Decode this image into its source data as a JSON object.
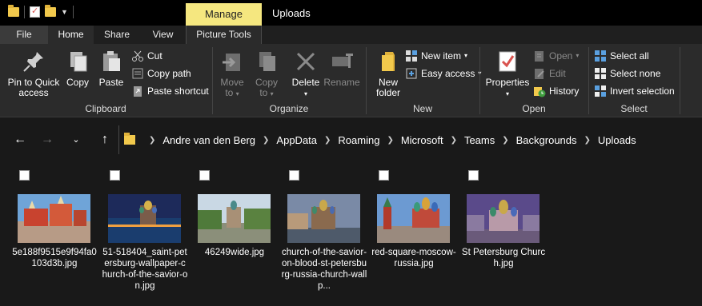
{
  "titlebar": {
    "manage_tab": "Manage",
    "window_title": "Uploads"
  },
  "tabs": {
    "file": "File",
    "home": "Home",
    "share": "Share",
    "view": "View",
    "picture_tools": "Picture Tools"
  },
  "ribbon": {
    "clipboard": {
      "label": "Clipboard",
      "pin_line1": "Pin to Quick",
      "pin_line2": "access",
      "copy": "Copy",
      "paste": "Paste",
      "cut": "Cut",
      "copy_path": "Copy path",
      "paste_shortcut": "Paste shortcut"
    },
    "organize": {
      "label": "Organize",
      "move_to_line1": "Move",
      "move_to_line2": "to",
      "copy_to_line1": "Copy",
      "copy_to_line2": "to",
      "delete": "Delete",
      "rename": "Rename"
    },
    "new": {
      "label": "New",
      "new_folder_line1": "New",
      "new_folder_line2": "folder",
      "new_item": "New item",
      "easy_access": "Easy access"
    },
    "open": {
      "label": "Open",
      "properties": "Properties",
      "open": "Open",
      "edit": "Edit",
      "history": "History"
    },
    "select": {
      "label": "Select",
      "select_all": "Select all",
      "select_none": "Select none",
      "invert_selection": "Invert selection"
    }
  },
  "nav": {
    "breadcrumbs": [
      "Andre van den Berg",
      "AppData",
      "Roaming",
      "Microsoft",
      "Teams",
      "Backgrounds",
      "Uploads"
    ]
  },
  "files": [
    {
      "name": "5e188f9515e9f94fa0103d3b.jpg"
    },
    {
      "name": "51-518404_saint-petersburg-wallpaper-church-of-the-savior-on.jpg"
    },
    {
      "name": "46249wide.jpg"
    },
    {
      "name": "church-of-the-savior-on-blood-st-petersburg-russia-church-wallp..."
    },
    {
      "name": "red-square-moscow-russia.jpg"
    },
    {
      "name": "St Petersburg Church.jpg"
    }
  ],
  "colors": {
    "manage_accent": "#f5e77f",
    "folder_yellow": "#f2c94c",
    "ribbon_bg": "#2b2b2b",
    "content_bg": "#191919"
  }
}
